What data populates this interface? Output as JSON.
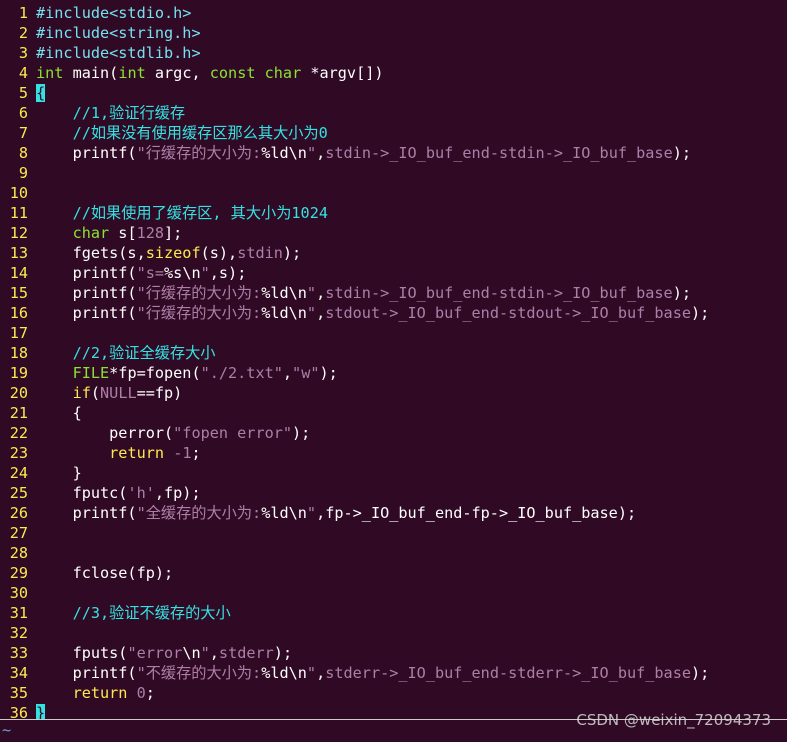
{
  "colors": {
    "background": "#300a24",
    "line_number": "#fce94f",
    "preprocessor": "#75e1f0",
    "type": "#8ae234",
    "keyword": "#fce94f",
    "comment": "#34e2e2",
    "string": "#ad7fa8",
    "cursor": "#34e2e2"
  },
  "lines": [
    {
      "n": "1",
      "tokens": [
        {
          "c": "pp",
          "t": "#include<stdio.h>"
        }
      ]
    },
    {
      "n": "2",
      "tokens": [
        {
          "c": "pp",
          "t": "#include<string.h>"
        }
      ]
    },
    {
      "n": "3",
      "tokens": [
        {
          "c": "pp",
          "t": "#include<stdlib.h>"
        }
      ]
    },
    {
      "n": "4",
      "tokens": [
        {
          "c": "ty",
          "t": "int"
        },
        {
          "c": "pl",
          "t": " main("
        },
        {
          "c": "ty",
          "t": "int"
        },
        {
          "c": "pl",
          "t": " argc, "
        },
        {
          "c": "ty",
          "t": "const"
        },
        {
          "c": "pl",
          "t": " "
        },
        {
          "c": "ty",
          "t": "char"
        },
        {
          "c": "pl",
          "t": " *argv[])"
        }
      ]
    },
    {
      "n": "5",
      "tokens": [
        {
          "c": "cs",
          "t": "{"
        }
      ]
    },
    {
      "n": "6",
      "tokens": [
        {
          "c": "pl",
          "t": "    "
        },
        {
          "c": "cm",
          "t": "//1,验证行缓存"
        }
      ]
    },
    {
      "n": "7",
      "tokens": [
        {
          "c": "pl",
          "t": "    "
        },
        {
          "c": "cm",
          "t": "//如果没有使用缓存区那么其大小为0"
        }
      ]
    },
    {
      "n": "8",
      "tokens": [
        {
          "c": "pl",
          "t": "    printf("
        },
        {
          "c": "st",
          "t": "\"行缓存的大小为:"
        },
        {
          "c": "pl",
          "t": "%ld"
        },
        {
          "c": "pl",
          "t": "\\n"
        },
        {
          "c": "st",
          "t": "\""
        },
        {
          "c": "pl",
          "t": ","
        },
        {
          "c": "st",
          "t": "stdin->_IO_buf_end-stdin->_IO_buf_base"
        },
        {
          "c": "pl",
          "t": ");"
        }
      ]
    },
    {
      "n": "9",
      "tokens": []
    },
    {
      "n": "10",
      "tokens": []
    },
    {
      "n": "11",
      "tokens": [
        {
          "c": "pl",
          "t": "    "
        },
        {
          "c": "cm",
          "t": "//如果使用了缓存区, 其大小为1024"
        }
      ]
    },
    {
      "n": "12",
      "tokens": [
        {
          "c": "pl",
          "t": "    "
        },
        {
          "c": "ty",
          "t": "char"
        },
        {
          "c": "pl",
          "t": " s["
        },
        {
          "c": "nu",
          "t": "128"
        },
        {
          "c": "pl",
          "t": "];"
        }
      ]
    },
    {
      "n": "13",
      "tokens": [
        {
          "c": "pl",
          "t": "    fgets(s,"
        },
        {
          "c": "kw",
          "t": "sizeof"
        },
        {
          "c": "pl",
          "t": "(s),"
        },
        {
          "c": "st",
          "t": "stdin"
        },
        {
          "c": "pl",
          "t": ");"
        }
      ]
    },
    {
      "n": "14",
      "tokens": [
        {
          "c": "pl",
          "t": "    printf("
        },
        {
          "c": "st",
          "t": "\"s="
        },
        {
          "c": "pl",
          "t": "%s\\n"
        },
        {
          "c": "st",
          "t": "\""
        },
        {
          "c": "pl",
          "t": ",s);"
        }
      ]
    },
    {
      "n": "15",
      "tokens": [
        {
          "c": "pl",
          "t": "    printf("
        },
        {
          "c": "st",
          "t": "\"行缓存的大小为:"
        },
        {
          "c": "pl",
          "t": "%ld\\n"
        },
        {
          "c": "st",
          "t": "\""
        },
        {
          "c": "pl",
          "t": ","
        },
        {
          "c": "st",
          "t": "stdin->_IO_buf_end-stdin->_IO_buf_base"
        },
        {
          "c": "pl",
          "t": ");"
        }
      ]
    },
    {
      "n": "16",
      "tokens": [
        {
          "c": "pl",
          "t": "    printf("
        },
        {
          "c": "st",
          "t": "\"行缓存的大小为:"
        },
        {
          "c": "pl",
          "t": "%ld\\n"
        },
        {
          "c": "st",
          "t": "\""
        },
        {
          "c": "pl",
          "t": ","
        },
        {
          "c": "st",
          "t": "stdout->_IO_buf_end-stdout->_IO_buf_base"
        },
        {
          "c": "pl",
          "t": ");"
        }
      ]
    },
    {
      "n": "17",
      "tokens": []
    },
    {
      "n": "18",
      "tokens": [
        {
          "c": "pl",
          "t": "    "
        },
        {
          "c": "cm",
          "t": "//2,验证全缓存大小"
        }
      ]
    },
    {
      "n": "19",
      "tokens": [
        {
          "c": "pl",
          "t": "    "
        },
        {
          "c": "ty",
          "t": "FILE"
        },
        {
          "c": "pl",
          "t": "*fp=fopen("
        },
        {
          "c": "st",
          "t": "\"./2.txt\""
        },
        {
          "c": "pl",
          "t": ","
        },
        {
          "c": "st",
          "t": "\"w\""
        },
        {
          "c": "pl",
          "t": ");"
        }
      ]
    },
    {
      "n": "20",
      "tokens": [
        {
          "c": "pl",
          "t": "    "
        },
        {
          "c": "kw",
          "t": "if"
        },
        {
          "c": "pl",
          "t": "("
        },
        {
          "c": "st",
          "t": "NULL"
        },
        {
          "c": "pl",
          "t": "==fp)"
        }
      ]
    },
    {
      "n": "21",
      "tokens": [
        {
          "c": "pl",
          "t": "    {"
        }
      ]
    },
    {
      "n": "22",
      "tokens": [
        {
          "c": "pl",
          "t": "        perror("
        },
        {
          "c": "st",
          "t": "\"fopen error\""
        },
        {
          "c": "pl",
          "t": ");"
        }
      ]
    },
    {
      "n": "23",
      "tokens": [
        {
          "c": "pl",
          "t": "        "
        },
        {
          "c": "kw",
          "t": "return"
        },
        {
          "c": "pl",
          "t": " "
        },
        {
          "c": "nu",
          "t": "-1"
        },
        {
          "c": "pl",
          "t": ";"
        }
      ]
    },
    {
      "n": "24",
      "tokens": [
        {
          "c": "pl",
          "t": "    }"
        }
      ]
    },
    {
      "n": "25",
      "tokens": [
        {
          "c": "pl",
          "t": "    fputc("
        },
        {
          "c": "st",
          "t": "'h'"
        },
        {
          "c": "pl",
          "t": ",fp);"
        }
      ]
    },
    {
      "n": "26",
      "tokens": [
        {
          "c": "pl",
          "t": "    printf("
        },
        {
          "c": "st",
          "t": "\"全缓存的大小为:"
        },
        {
          "c": "pl",
          "t": "%ld\\n"
        },
        {
          "c": "st",
          "t": "\""
        },
        {
          "c": "pl",
          "t": ",fp->_IO_buf_end-fp->_IO_buf_base);"
        }
      ]
    },
    {
      "n": "27",
      "tokens": []
    },
    {
      "n": "28",
      "tokens": []
    },
    {
      "n": "29",
      "tokens": [
        {
          "c": "pl",
          "t": "    fclose(fp);"
        }
      ]
    },
    {
      "n": "30",
      "tokens": []
    },
    {
      "n": "31",
      "tokens": [
        {
          "c": "pl",
          "t": "    "
        },
        {
          "c": "cm",
          "t": "//3,验证不缓存的大小"
        }
      ]
    },
    {
      "n": "32",
      "tokens": []
    },
    {
      "n": "33",
      "tokens": [
        {
          "c": "pl",
          "t": "    fputs("
        },
        {
          "c": "st",
          "t": "\"error"
        },
        {
          "c": "pl",
          "t": "\\n"
        },
        {
          "c": "st",
          "t": "\""
        },
        {
          "c": "pl",
          "t": ","
        },
        {
          "c": "st",
          "t": "stderr"
        },
        {
          "c": "pl",
          "t": ");"
        }
      ]
    },
    {
      "n": "34",
      "tokens": [
        {
          "c": "pl",
          "t": "    printf("
        },
        {
          "c": "st",
          "t": "\"不缓存的大小为:"
        },
        {
          "c": "pl",
          "t": "%ld\\n"
        },
        {
          "c": "st",
          "t": "\""
        },
        {
          "c": "pl",
          "t": ","
        },
        {
          "c": "st",
          "t": "stderr->_IO_buf_end-stderr->_IO_buf_base"
        },
        {
          "c": "pl",
          "t": ");"
        }
      ]
    },
    {
      "n": "35",
      "tokens": [
        {
          "c": "pl",
          "t": "    "
        },
        {
          "c": "kw",
          "t": "return"
        },
        {
          "c": "pl",
          "t": " "
        },
        {
          "c": "nu",
          "t": "0"
        },
        {
          "c": "pl",
          "t": ";"
        }
      ]
    },
    {
      "n": "36",
      "tokens": [
        {
          "c": "cs",
          "t": "}"
        }
      ]
    }
  ],
  "empty_line_marker": "~",
  "watermark": "CSDN @weixin_72094373"
}
